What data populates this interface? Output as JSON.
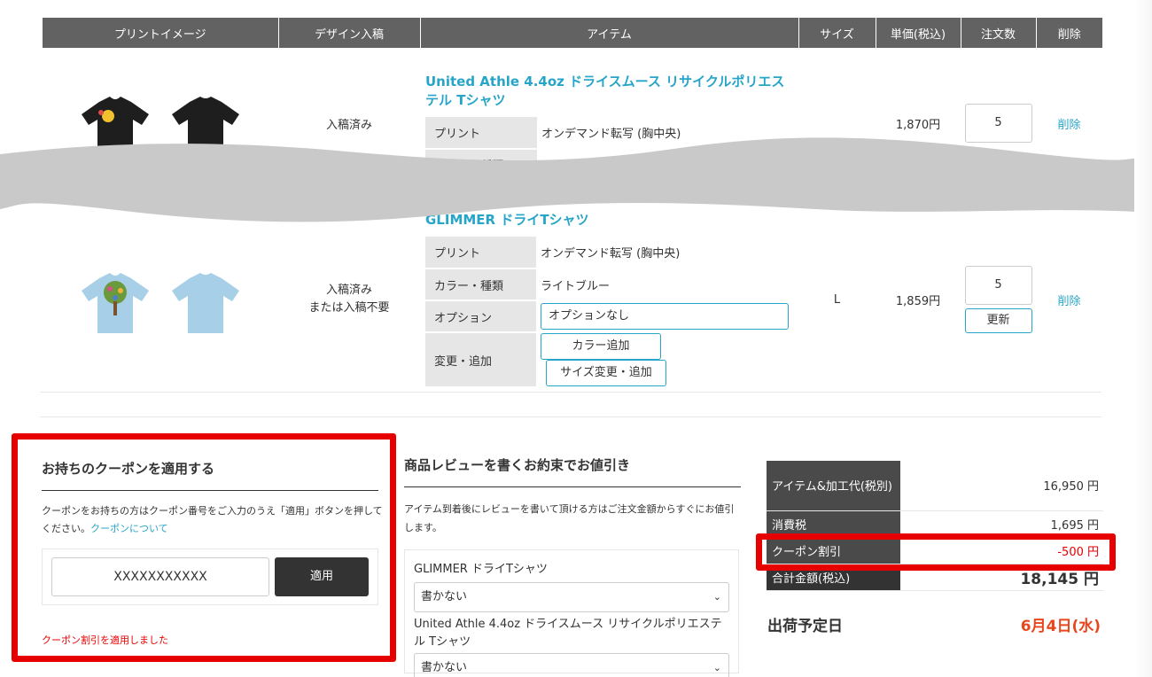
{
  "table": {
    "headers": [
      "プリントイメージ",
      "デザイン入稿",
      "アイテム",
      "サイズ",
      "単価(税込)",
      "注文数",
      "削除"
    ]
  },
  "item1": {
    "title": "United Athle 4.4oz ドライスムース リサイクルポリエステル Tシャツ",
    "design_status": "入稿済み",
    "print_label": "プリント",
    "print_value": "オンデマンド転写 (胸中央)",
    "color_label": "カラー・種類",
    "price": "1,870円",
    "qty": "5",
    "delete": "削除"
  },
  "item2": {
    "title": "GLIMMER ドライTシャツ",
    "design_status_1": "入稿済み",
    "design_status_2": "または入稿不要",
    "print_label": "プリント",
    "print_value": "オンデマンド転写 (胸中央)",
    "color_label": "カラー・種類",
    "color_value": "ライトブルー",
    "option_label": "オプション",
    "option_value": "オプションなし",
    "change_label": "変更・追加",
    "add_color": "カラー追加",
    "change_size": "サイズ変更・追加",
    "size": "L",
    "price": "1,859円",
    "qty": "5",
    "update": "更新",
    "delete": "削除"
  },
  "coupon": {
    "title": "お持ちのクーポンを適用する",
    "desc": "クーポンをお持ちの方はクーポン番号をご入力のうえ「適用」ボタンを押してください。",
    "link": "クーポンについて",
    "code": "XXXXXXXXXXX",
    "apply": "適用",
    "message": "クーポン割引を適用しました"
  },
  "review": {
    "title": "商品レビューを書くお約束でお値引き",
    "desc": "アイテム到着後にレビューを書いて頂ける方はご注文金額からすぐにお値引します。",
    "item1_name": "GLIMMER ドライTシャツ",
    "item1_select": "書かない",
    "item2_name": "United Athle 4.4oz ドライスムース リサイクルポリエステル Tシャツ",
    "item2_select": "書かない"
  },
  "totals": {
    "subtotal_label": "アイテム&加工代(税別)",
    "subtotal": "16,950 円",
    "tax_label": "消費税",
    "tax": "1,695 円",
    "coupon_label": "クーポン割引",
    "coupon": "-500 円",
    "total_label": "合計金額(税込)",
    "total": "18,145 円"
  },
  "shipping": {
    "label": "出荷予定日",
    "date": "6月4日(水)"
  },
  "colors": {
    "accent": "#27a5c8",
    "header_bg": "#626262",
    "highlight": "#e60000",
    "shipping_date": "#e8471e"
  }
}
